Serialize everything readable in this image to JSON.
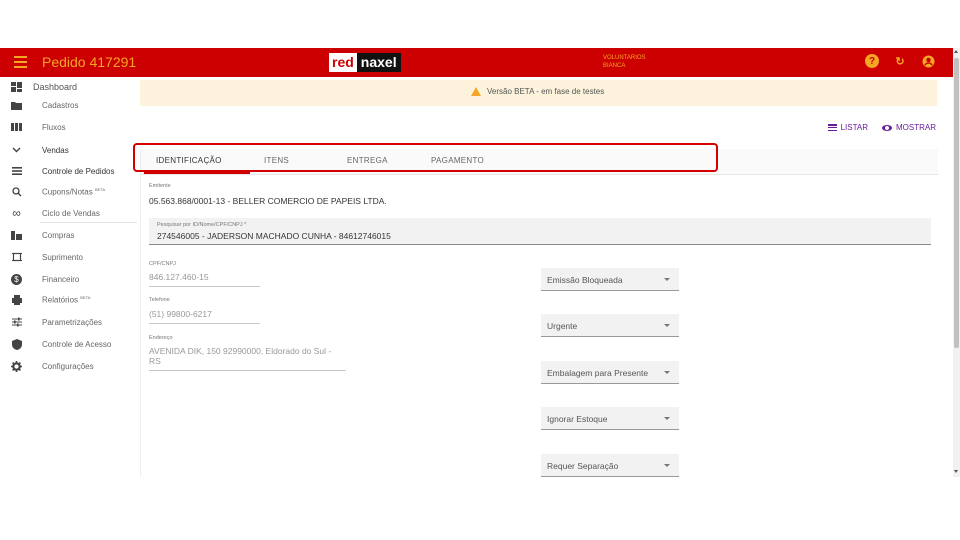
{
  "header": {
    "title": "Pedido 417291",
    "logo_left": "red",
    "logo_right": "naxel",
    "company": "VOLUNTARIOS",
    "user": "BIANCA"
  },
  "sidebar": {
    "items": [
      {
        "label": "Dashboard",
        "icon": "dashboard-icon"
      },
      {
        "label": "Cadastros",
        "icon": "folder-icon"
      },
      {
        "label": "Fluxos",
        "icon": "columns-icon"
      },
      {
        "label": "Vendas",
        "icon": "chevron-down-icon"
      },
      {
        "label": "Controle de Pedidos",
        "icon": "list-icon"
      },
      {
        "label": "Cupons/Notas",
        "badge": "BETA",
        "icon": "search-receipt-icon"
      },
      {
        "label": "Ciclo de Vendas",
        "icon": "infinity-icon"
      },
      {
        "label": "Compras",
        "icon": "purchases-icon"
      },
      {
        "label": "Suprimento",
        "icon": "supply-icon"
      },
      {
        "label": "Financeiro",
        "icon": "dollar-icon"
      },
      {
        "label": "Relatórios",
        "badge": "BETA",
        "icon": "print-icon"
      },
      {
        "label": "Parametrizações",
        "icon": "sliders-icon"
      },
      {
        "label": "Controle de Acesso",
        "icon": "shield-icon"
      },
      {
        "label": "Configurações",
        "icon": "gear-icon"
      }
    ]
  },
  "banner": {
    "text": "Versão BETA - em fase de testes"
  },
  "actions": {
    "list": "LISTAR",
    "show": "MOSTRAR"
  },
  "tabs": [
    {
      "label": "IDENTIFICAÇÃO",
      "active": true
    },
    {
      "label": "ITENS"
    },
    {
      "label": "ENTREGA"
    },
    {
      "label": "PAGAMENTO"
    }
  ],
  "form": {
    "emitente_label": "Emitente",
    "emitente_value": "05.563.868/0001-13 - BELLER COMERCIO DE PAPEIS LTDA.",
    "search_label": "Pesquisar por ID/Nome/CPF/CNPJ *",
    "search_value": "274546005 - JADERSON MACHADO CUNHA - 84612746015",
    "cpf_label": "CPF/CNPJ",
    "cpf_value": "846.127.460-15",
    "phone_label": "Telefone",
    "phone_value": "(51) 99800-6217",
    "address_label": "Endereço",
    "address_value_1": "AVENIDA DIK, 150 92990000, Eldorado do Sul -",
    "address_value_2": "RS"
  },
  "selects": [
    {
      "label": "Emissão Bloqueada"
    },
    {
      "label": "Urgente"
    },
    {
      "label": "Embalagem para Presente"
    },
    {
      "label": "Ignorar Estoque"
    },
    {
      "label": "Requer Separação"
    }
  ],
  "colors": {
    "primary": "#cc0000",
    "accent": "#f5a623",
    "action": "#6a1b9a",
    "banner": "#fdf3dc"
  }
}
